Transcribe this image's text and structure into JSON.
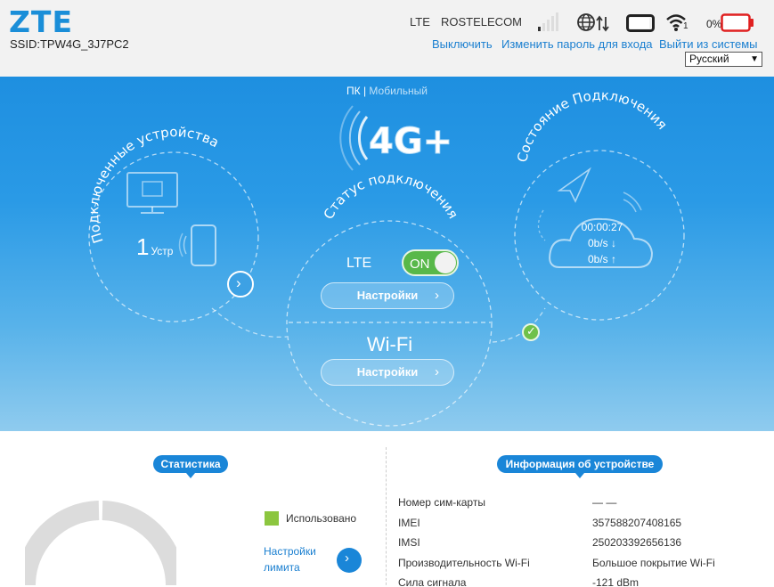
{
  "header": {
    "logo": "ZTE",
    "ssid": "SSID:TPW4G_3J7PC2",
    "network_type": "LTE",
    "operator": "ROSTELECOM",
    "wifi_clients": "1",
    "battery_percent": "0%",
    "links": {
      "disconnect": "Выключить",
      "change_password": "Изменить пароль для входа",
      "logout": "Выйти из системы"
    },
    "language": "Русский"
  },
  "hero": {
    "mode_pc": "ПК",
    "mode_separator": "|",
    "mode_mobile": "Мобильный",
    "badge": "4G+",
    "connected_devices_title": "Подключенные устройства",
    "device_count": "1",
    "device_unit": "Устр",
    "connection_status_title": "Статус подключения",
    "lte_label": "LTE",
    "lte_toggle": "ON",
    "lte_settings": "Настройки",
    "wifi_label": "Wi-Fi",
    "wifi_settings": "Настройки",
    "connection_state_title": "Состояние Подключения",
    "connected_time": "00:00:27",
    "download_rate": "0b/s ↓",
    "upload_rate": "0b/s ↑"
  },
  "statistics": {
    "title": "Статистика",
    "legend_used": "Использовано",
    "limit_settings_line1": "Настройки",
    "limit_settings_line2": "лимита",
    "used_color": "#8cc63f"
  },
  "device_info": {
    "title": "Информация об устройстве",
    "rows": [
      {
        "key": "Номер сим-карты",
        "value": "— —"
      },
      {
        "key": "IMEI",
        "value": "357588207408165"
      },
      {
        "key": "IMSI",
        "value": "250203392656136"
      },
      {
        "key": "Производительность Wi-Fi",
        "value": "Большое покрытие Wi-Fi"
      },
      {
        "key": "Сила сигнала",
        "value": "-121 dBm"
      }
    ]
  }
}
